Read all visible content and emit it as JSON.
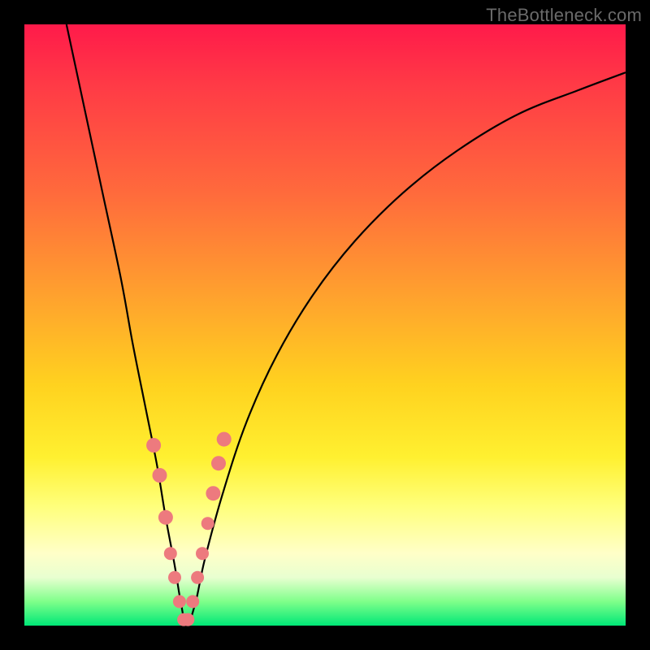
{
  "watermark": "TheBottleneck.com",
  "chart_data": {
    "type": "line",
    "title": "",
    "xlabel": "",
    "ylabel": "",
    "xlim": [
      0,
      100
    ],
    "ylim": [
      0,
      100
    ],
    "series": [
      {
        "name": "bottleneck-curve",
        "x": [
          7,
          10,
          13,
          16,
          18,
          20,
          22,
          23.5,
          25,
          26,
          27,
          28.5,
          30,
          33,
          37,
          42,
          48,
          55,
          63,
          72,
          82,
          92,
          100
        ],
        "y": [
          100,
          86,
          72,
          58,
          47,
          37,
          27,
          18,
          10,
          4,
          0,
          4,
          11,
          22,
          34,
          45,
          55,
          64,
          72,
          79,
          85,
          89,
          92
        ]
      }
    ],
    "markers": {
      "name": "highlight-points",
      "color": "#ed7a7e",
      "x": [
        21.5,
        22.5,
        23.5,
        24.3,
        25.0,
        25.8,
        26.5,
        27.2,
        28.0,
        28.8,
        29.6,
        30.5,
        31.4,
        32.3,
        33.2
      ],
      "y": [
        30,
        25,
        18,
        12,
        8,
        4,
        1,
        1,
        4,
        8,
        12,
        17,
        22,
        27,
        31
      ],
      "r": [
        9,
        9,
        9,
        8,
        8,
        8,
        8,
        8,
        8,
        8,
        8,
        8,
        9,
        9,
        9
      ]
    }
  }
}
